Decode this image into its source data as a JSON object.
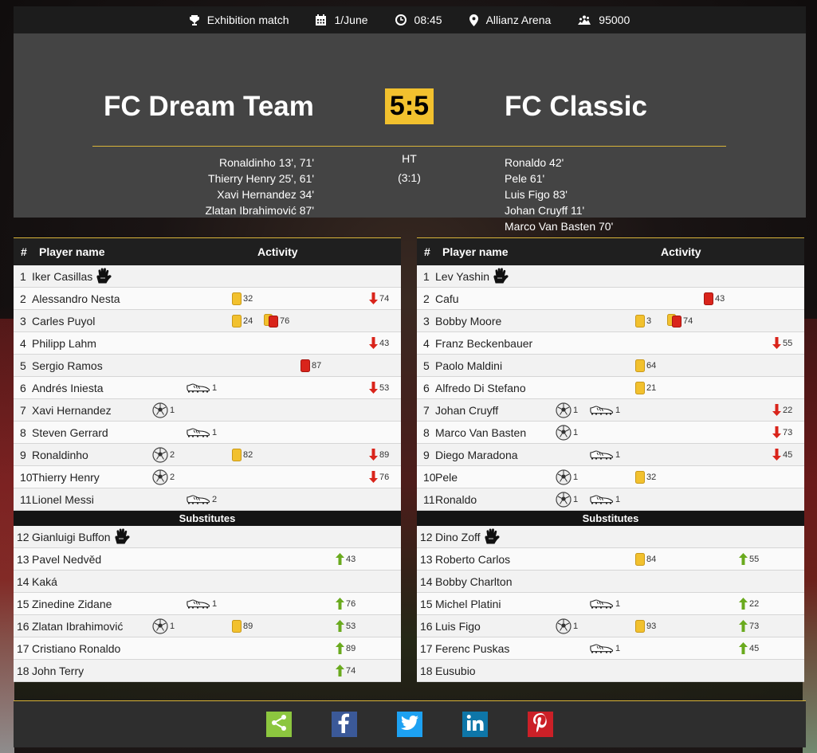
{
  "match": {
    "type": "Exhibition match",
    "date": "1/June",
    "time": "08:45",
    "venue": "Allianz Arena",
    "attendance": "95000"
  },
  "scoreboard": {
    "home_team": "FC Dream Team",
    "away_team": "FC Classic",
    "score": "5:5",
    "ht_label": "HT",
    "ht_score": "(3:1)",
    "home_scorers": [
      "Ronaldinho 13', 71'",
      "Thierry Henry 25', 61'",
      "Xavi Hernandez 34'",
      "Zlatan Ibrahimović 87'"
    ],
    "away_scorers": [
      "Ronaldo 42'",
      "Pele 61'",
      "Luis Figo 83'",
      "Johan Cruyff 11'",
      "Marco Van Basten 70'"
    ]
  },
  "table_headers": {
    "num": "#",
    "name": "Player name",
    "activity": "Activity"
  },
  "substitutes_label": "Substitutes",
  "home_lineup": [
    {
      "num": "1",
      "name": "Iker Casillas",
      "gk": true
    },
    {
      "num": "2",
      "name": "Alessandro Nesta",
      "yellow": "32",
      "off": "74"
    },
    {
      "num": "3",
      "name": "Carles Puyol",
      "yellow": "24",
      "second_yellow": "76"
    },
    {
      "num": "4",
      "name": "Philipp Lahm",
      "off": "43"
    },
    {
      "num": "5",
      "name": "Sergio Ramos",
      "red": "87"
    },
    {
      "num": "6",
      "name": "Andrés Iniesta",
      "assist": "1",
      "off": "53"
    },
    {
      "num": "7",
      "name": "Xavi Hernandez",
      "goal": "1"
    },
    {
      "num": "8",
      "name": "Steven Gerrard",
      "assist": "1"
    },
    {
      "num": "9",
      "name": "Ronaldinho",
      "goal": "2",
      "yellow": "82",
      "off": "89"
    },
    {
      "num": "10",
      "name": "Thierry Henry",
      "goal": "2",
      "off": "76"
    },
    {
      "num": "11",
      "name": "Lionel Messi",
      "assist": "2"
    }
  ],
  "home_subs": [
    {
      "num": "12",
      "name": "Gianluigi Buffon",
      "gk": true
    },
    {
      "num": "13",
      "name": "Pavel Nedvěd",
      "on": "43"
    },
    {
      "num": "14",
      "name": "Kaká"
    },
    {
      "num": "15",
      "name": "Zinedine Zidane",
      "assist": "1",
      "on": "76"
    },
    {
      "num": "16",
      "name": "Zlatan Ibrahimović",
      "goal": "1",
      "yellow": "89",
      "on": "53"
    },
    {
      "num": "17",
      "name": "Cristiano Ronaldo",
      "on": "89"
    },
    {
      "num": "18",
      "name": "John Terry",
      "on": "74"
    }
  ],
  "away_lineup": [
    {
      "num": "1",
      "name": "Lev Yashin",
      "gk": true
    },
    {
      "num": "2",
      "name": "Cafu",
      "red": "43"
    },
    {
      "num": "3",
      "name": "Bobby Moore",
      "yellow": "3",
      "second_yellow": "74"
    },
    {
      "num": "4",
      "name": "Franz Beckenbauer",
      "off": "55"
    },
    {
      "num": "5",
      "name": "Paolo Maldini",
      "yellow": "64"
    },
    {
      "num": "6",
      "name": "Alfredo Di Stefano",
      "yellow": "21"
    },
    {
      "num": "7",
      "name": "Johan Cruyff",
      "goal": "1",
      "assist": "1",
      "off": "22"
    },
    {
      "num": "8",
      "name": "Marco Van Basten",
      "goal": "1",
      "off": "73"
    },
    {
      "num": "9",
      "name": "Diego Maradona",
      "assist": "1",
      "off": "45"
    },
    {
      "num": "10",
      "name": "Pele",
      "goal": "1",
      "yellow": "32"
    },
    {
      "num": "11",
      "name": "Ronaldo",
      "goal": "1",
      "assist": "1"
    }
  ],
  "away_subs": [
    {
      "num": "12",
      "name": "Dino Zoff",
      "gk": true
    },
    {
      "num": "13",
      "name": "Roberto Carlos",
      "yellow": "84",
      "on": "55"
    },
    {
      "num": "14",
      "name": "Bobby Charlton"
    },
    {
      "num": "15",
      "name": "Michel Platini",
      "assist": "1",
      "on": "22"
    },
    {
      "num": "16",
      "name": "Luis Figo",
      "goal": "1",
      "yellow": "93",
      "on": "73"
    },
    {
      "num": "17",
      "name": "Ferenc Puskas",
      "assist": "1",
      "on": "45"
    },
    {
      "num": "18",
      "name": "Eusubio"
    }
  ],
  "share": [
    {
      "name": "share",
      "color": "#8cc63f"
    },
    {
      "name": "facebook",
      "color": "#3b5998"
    },
    {
      "name": "twitter",
      "color": "#1da1f2"
    },
    {
      "name": "linkedin",
      "color": "#0e76a8"
    },
    {
      "name": "pinterest",
      "color": "#cb2027"
    }
  ]
}
